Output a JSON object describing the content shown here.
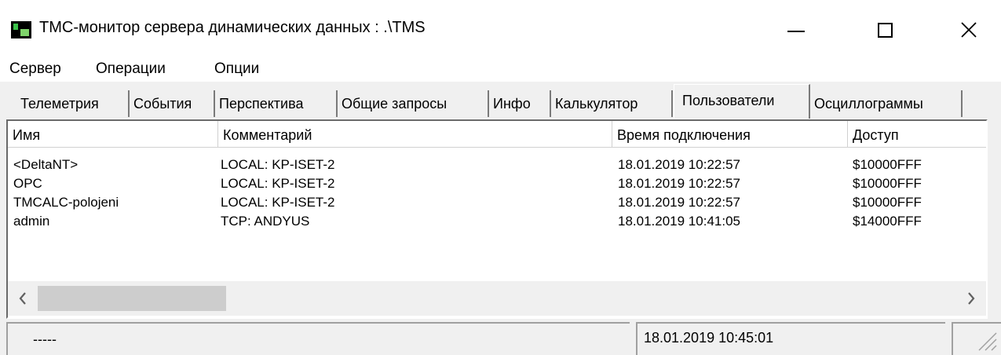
{
  "window": {
    "title": "ТМС-монитор сервера динамических данных :  .\\TMS",
    "app_icon": "tms-app-icon"
  },
  "menu": {
    "items": [
      "Сервер",
      "Операции",
      "Опции"
    ]
  },
  "tabs": {
    "items": [
      "Телеметрия",
      "События",
      "Перспектива",
      "Общие запросы",
      "Инфо",
      "Калькулятор",
      "Пользователи",
      "Осциллограммы"
    ],
    "active": "Пользователи"
  },
  "users_table": {
    "columns": [
      "Имя",
      "Комментарий",
      "Время подключения",
      "Доступ"
    ],
    "rows": [
      [
        "<DeltaNT>",
        "LOCAL: KP-ISET-2",
        "18.01.2019 10:22:57",
        "$10000FFF"
      ],
      [
        "OPC",
        "LOCAL: KP-ISET-2",
        "18.01.2019 10:22:57",
        "$10000FFF"
      ],
      [
        "TMCALC-polojeni",
        "LOCAL: KP-ISET-2",
        "18.01.2019 10:22:57",
        "$10000FFF"
      ],
      [
        "admin",
        "TCP: ANDYUS",
        "18.01.2019 10:41:05",
        "$14000FFF"
      ]
    ]
  },
  "statusbar": {
    "left": "-----",
    "datetime": "18.01.2019 10:45:01"
  }
}
